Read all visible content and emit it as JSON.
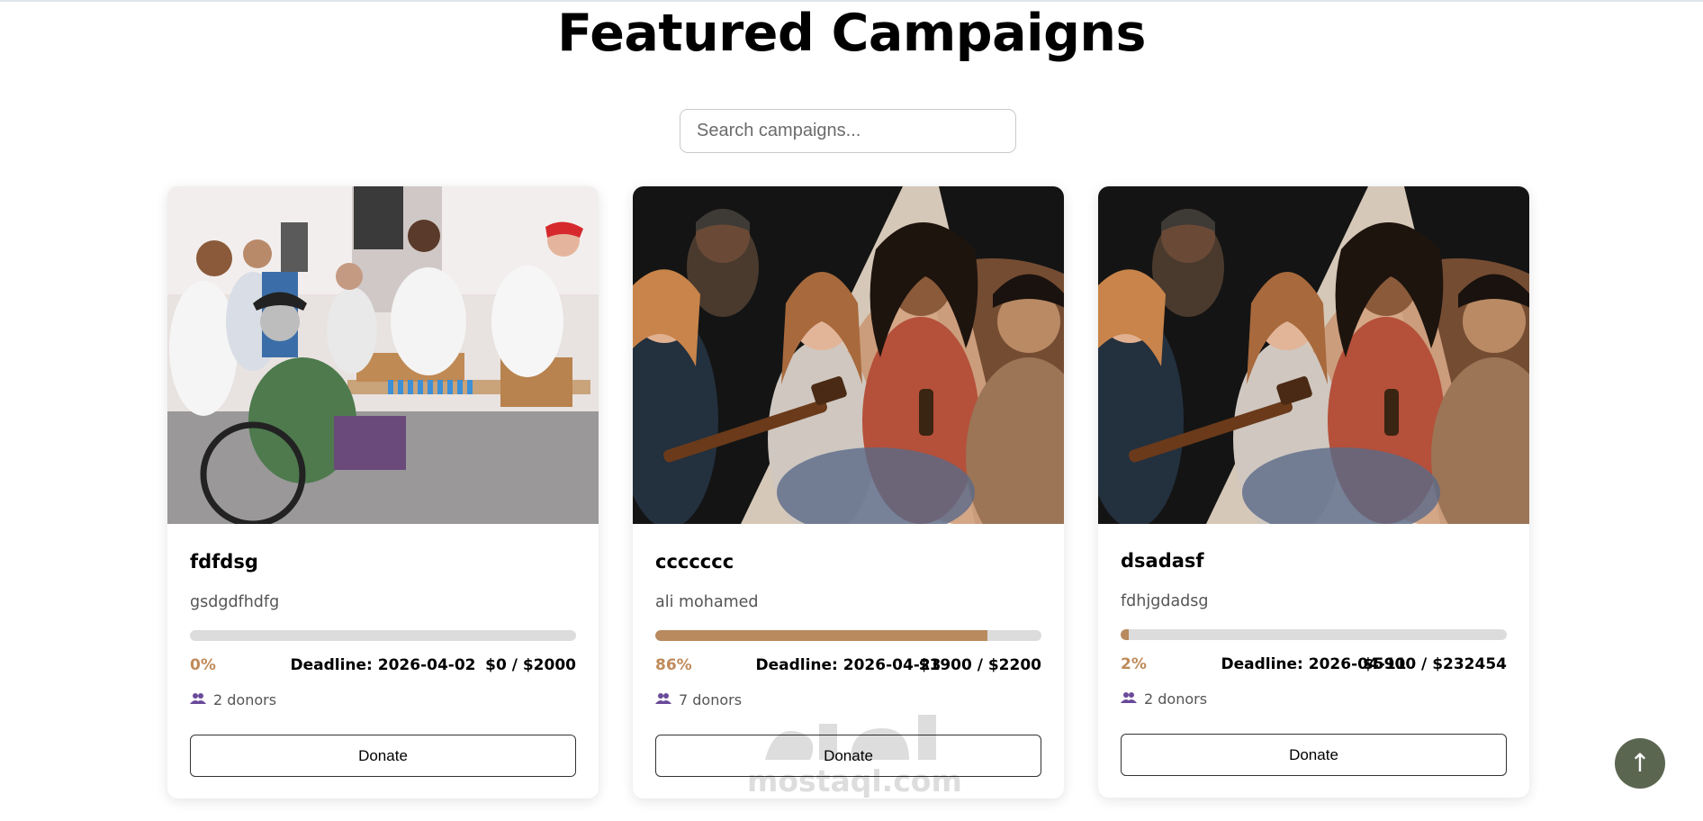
{
  "page": {
    "title": "Featured Campaigns",
    "search_placeholder": "Search campaigns..."
  },
  "campaigns": [
    {
      "title": "fdfdsg",
      "description": "gsdgdfhdfg",
      "progress_percent": 0,
      "progress_label": "0%",
      "deadline": "Deadline: 2026-04-02",
      "amount": "$0 / $2000",
      "donors": "2 donors",
      "donate_label": "Donate",
      "image": "volunteers-handing-out-water"
    },
    {
      "title": "ccccccc",
      "description": "ali mohamed",
      "progress_percent": 86,
      "progress_label": "86%",
      "deadline": "Deadline: 2026-04-23",
      "amount": "$1900 / $2200",
      "donors": "7 donors",
      "donate_label": "Donate",
      "image": "friends-laughing-around-campfire-with-guitar"
    },
    {
      "title": "dsadasf",
      "description": "fdhjgdadsg",
      "progress_percent": 2,
      "progress_label": "2%",
      "deadline": "Deadline: 2026-04-11",
      "amount": "$5900 / $232454",
      "donors": "2 donors",
      "donate_label": "Donate",
      "image": "friends-laughing-around-campfire-with-guitar"
    }
  ],
  "scroll_top": {
    "icon": "arrow-up-icon",
    "label": "↑"
  },
  "watermark": {
    "text": "mostaql.com",
    "logo": "مستقل"
  },
  "colors": {
    "progress_fill": "#b98a5e",
    "progress_track": "#dcdcdc",
    "percent_text": "#c08a5a",
    "donor_icon": "#6a4a9a",
    "scroll_top_bg": "#5b6651"
  }
}
